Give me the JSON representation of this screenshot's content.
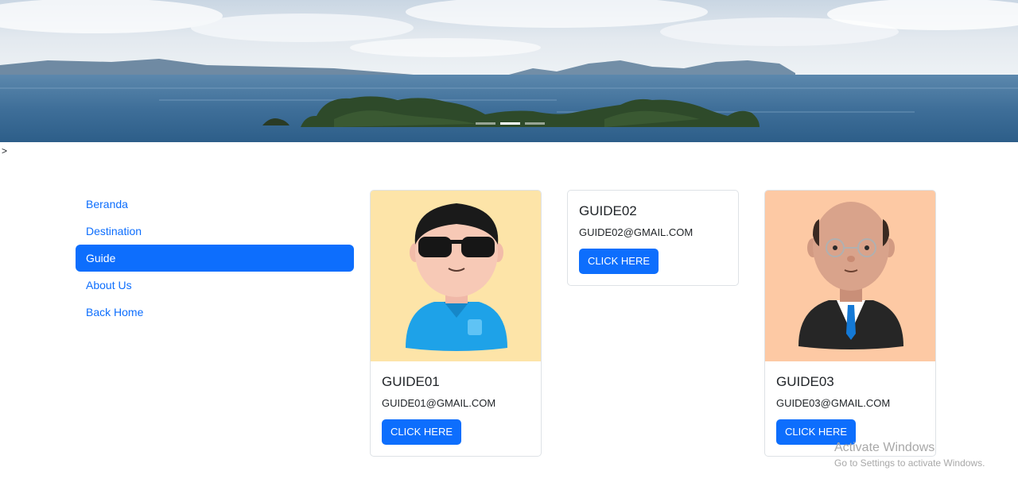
{
  "hero": {
    "slides": 3,
    "active_slide": 2
  },
  "stray_text": ">",
  "sidebar": {
    "items": [
      {
        "label": "Beranda",
        "active": false
      },
      {
        "label": "Destination",
        "active": false
      },
      {
        "label": "Guide",
        "active": true
      },
      {
        "label": "About Us",
        "active": false
      },
      {
        "label": "Back Home",
        "active": false
      }
    ]
  },
  "cards": [
    {
      "name": "GUIDE01",
      "email": "GUIDE01@GMAIL.COM",
      "button": "CLICK HERE",
      "avatar": "man-sunglasses-avatar",
      "avatar_bg": "#fde4a8"
    },
    {
      "name": "GUIDE02",
      "email": "GUIDE02@GMAIL.COM",
      "button": "CLICK HERE",
      "avatar": "",
      "avatar_bg": ""
    },
    {
      "name": "GUIDE03",
      "email": "GUIDE03@GMAIL.COM",
      "button": "CLICK HERE",
      "avatar": "bald-businessman-avatar",
      "avatar_bg": "#fdc9a4"
    }
  ],
  "watermark": {
    "title": "Activate Windows",
    "subtitle": "Go to Settings to activate Windows."
  },
  "colors": {
    "primary": "#0d6efd",
    "card_border": "#dee2e6"
  }
}
